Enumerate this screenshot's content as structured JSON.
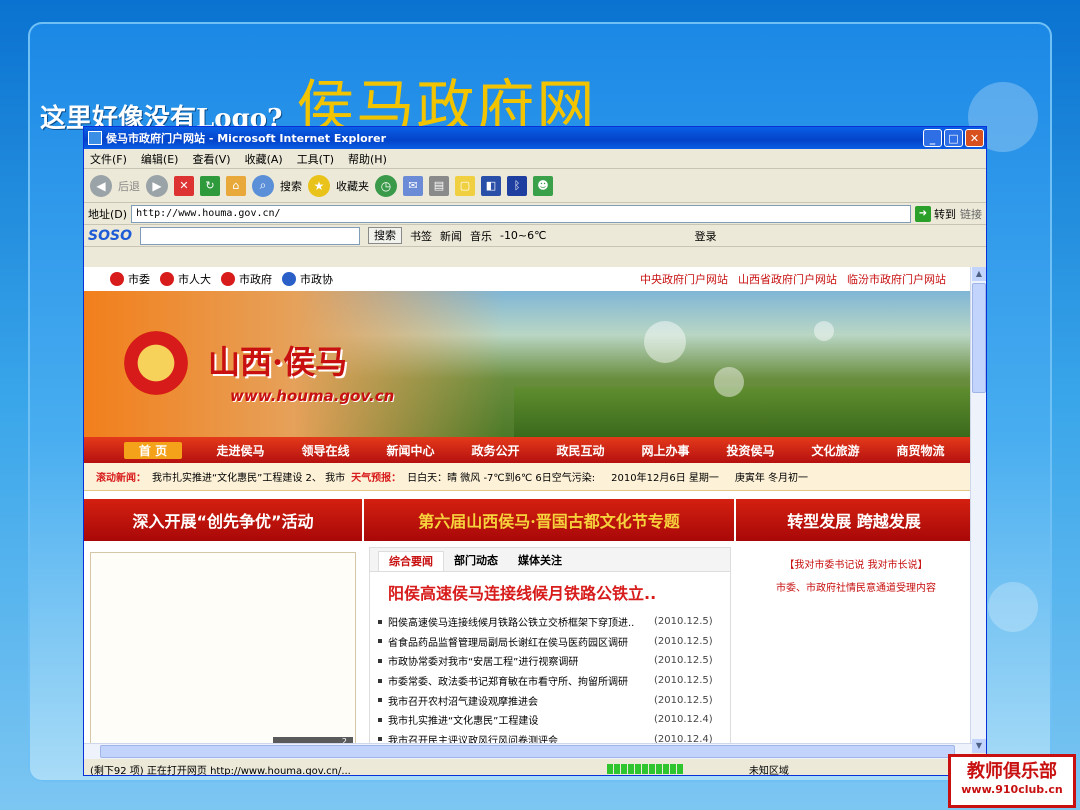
{
  "slide": {
    "question": "这里好像没有Logo?",
    "big_title": "侯马政府网",
    "watermark_title": "教师俱乐部",
    "watermark_url": "www.910club.cn"
  },
  "ie": {
    "window_title": "侯马市政府门户网站 - Microsoft Internet Explorer",
    "menu": [
      "文件(F)",
      "编辑(E)",
      "查看(V)",
      "收藏(A)",
      "工具(T)",
      "帮助(H)"
    ],
    "toolbar": {
      "back": "后退",
      "search": "搜索",
      "favorites": "收藏夹"
    },
    "address_label": "地址(D)",
    "address_value": "http://www.houma.gov.cn/",
    "go_label": "转到",
    "links_label": "链接",
    "soso": {
      "logo": "SOSO",
      "search_btn": "搜索",
      "items": [
        "书签",
        "新闻",
        "音乐",
        "-10~6℃",
        "登录"
      ]
    },
    "status_text": "(剩下92 项) 正在打开网页 http://www.houma.gov.cn/...",
    "status_zone": "未知区域"
  },
  "site": {
    "top_nav": [
      "市委",
      "市人大",
      "市政府",
      "市政协"
    ],
    "top_links": [
      "中央政府门户网站",
      "山西省政府门户网站",
      "临汾市政府门户网站"
    ],
    "banner_name": "山西·侯马",
    "banner_url": "www.houma.gov.cn",
    "menu": [
      "首 页",
      "走进侯马",
      "领导在线",
      "新闻中心",
      "政务公开",
      "政民互动",
      "网上办事",
      "投资侯马",
      "文化旅游",
      "商贸物流"
    ],
    "news_label": "滚动新闻：",
    "news_text": "我市扎实推进“文化惠民”工程建设  2、 我市",
    "weather_label": "天气预报：",
    "weather_text": "日白天：晴 微风 -7℃到6℃ 6日空气污染:",
    "date_text": "2010年12月6日 星期一",
    "lunar_text": "庚寅年 冬月初一",
    "promo": [
      "深入开展“创先争优”活动",
      "第六届山西侯马·晋国古都文化节专题",
      "转型发展 跨越发展"
    ],
    "pager": "2",
    "tabs": [
      "综合要闻",
      "部门动态",
      "媒体关注"
    ],
    "headline": "阳侯高速侯马连接线候月铁路公铁立..",
    "news": [
      {
        "title": "阳侯高速侯马连接线候月铁路公铁立交桥框架下穿顶进..",
        "date": "(2010.12.5)"
      },
      {
        "title": "省食品药品监督管理局副局长谢红在侯马医药园区调研",
        "date": "(2010.12.5)"
      },
      {
        "title": "市政协常委对我市“安居工程”进行视察调研",
        "date": "(2010.12.5)"
      },
      {
        "title": "市委常委、政法委书记郑育敏在市看守所、拘留所调研",
        "date": "(2010.12.5)"
      },
      {
        "title": "我市召开农村沼气建设观摩推进会",
        "date": "(2010.12.5)"
      },
      {
        "title": "我市扎实推进“文化惠民”工程建设",
        "date": "(2010.12.4)"
      },
      {
        "title": "我市召开民主评议政风行风问卷测评会",
        "date": "(2010.12.4)"
      }
    ],
    "right_title": "【我对市委书记说 我对市长说】",
    "right_text": "市委、市政府社情民意通道受理内容"
  }
}
